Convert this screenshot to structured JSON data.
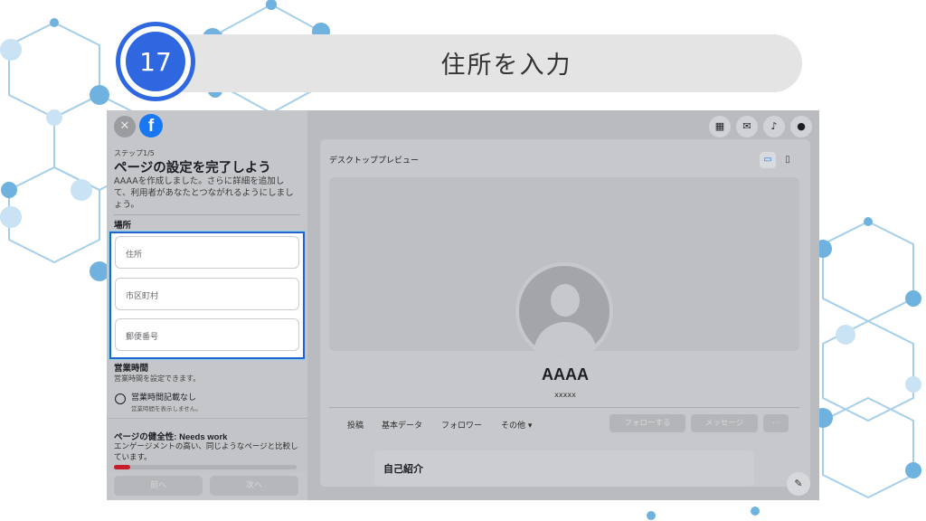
{
  "tutorial": {
    "step_number": "17",
    "step_title": "住所を入力"
  },
  "colors": {
    "badge": "#2f67e0",
    "highlight_border": "#2463c9",
    "facebook_blue": "#1877f2",
    "health_red": "#c81d2b"
  },
  "sidebar": {
    "close_icon": "close-icon",
    "logo": "facebook-logo",
    "step_label": "ステップ1/5",
    "heading": "ページの設定を完了しよう",
    "description": "AAAAを作成しました。さらに詳細を追加して、利用者があなたとつながれるようにしましょう。",
    "location_label": "場所",
    "fields": {
      "address_placeholder": "住所",
      "city_placeholder": "市区町村",
      "zip_placeholder": "郵便番号"
    },
    "hours": {
      "title": "営業時間",
      "description": "営業時間を設定できます。",
      "option_label": "営業時間記載なし",
      "option_sub": "営業時間を表示しません。"
    },
    "health": {
      "title": "ページの健全性: Needs work",
      "description": "エンゲージメントの高い、同じようなページと比較しています。",
      "level_fraction": 0.09
    },
    "prev_button": "前へ",
    "next_button": "次へ"
  },
  "topbar": {
    "icons": [
      "apps-grid-icon",
      "messenger-icon",
      "bell-icon",
      "account-icon"
    ]
  },
  "preview": {
    "label": "デスクトッププレビュー",
    "page_name": "AAAA",
    "category": "xxxxx",
    "tabs": [
      "投稿",
      "基本データ",
      "フォロワー",
      "その他 ▾"
    ],
    "follow_button": "フォローする",
    "message_button": "メッセージ",
    "more_button": "···",
    "about_title": "自己紹介"
  }
}
